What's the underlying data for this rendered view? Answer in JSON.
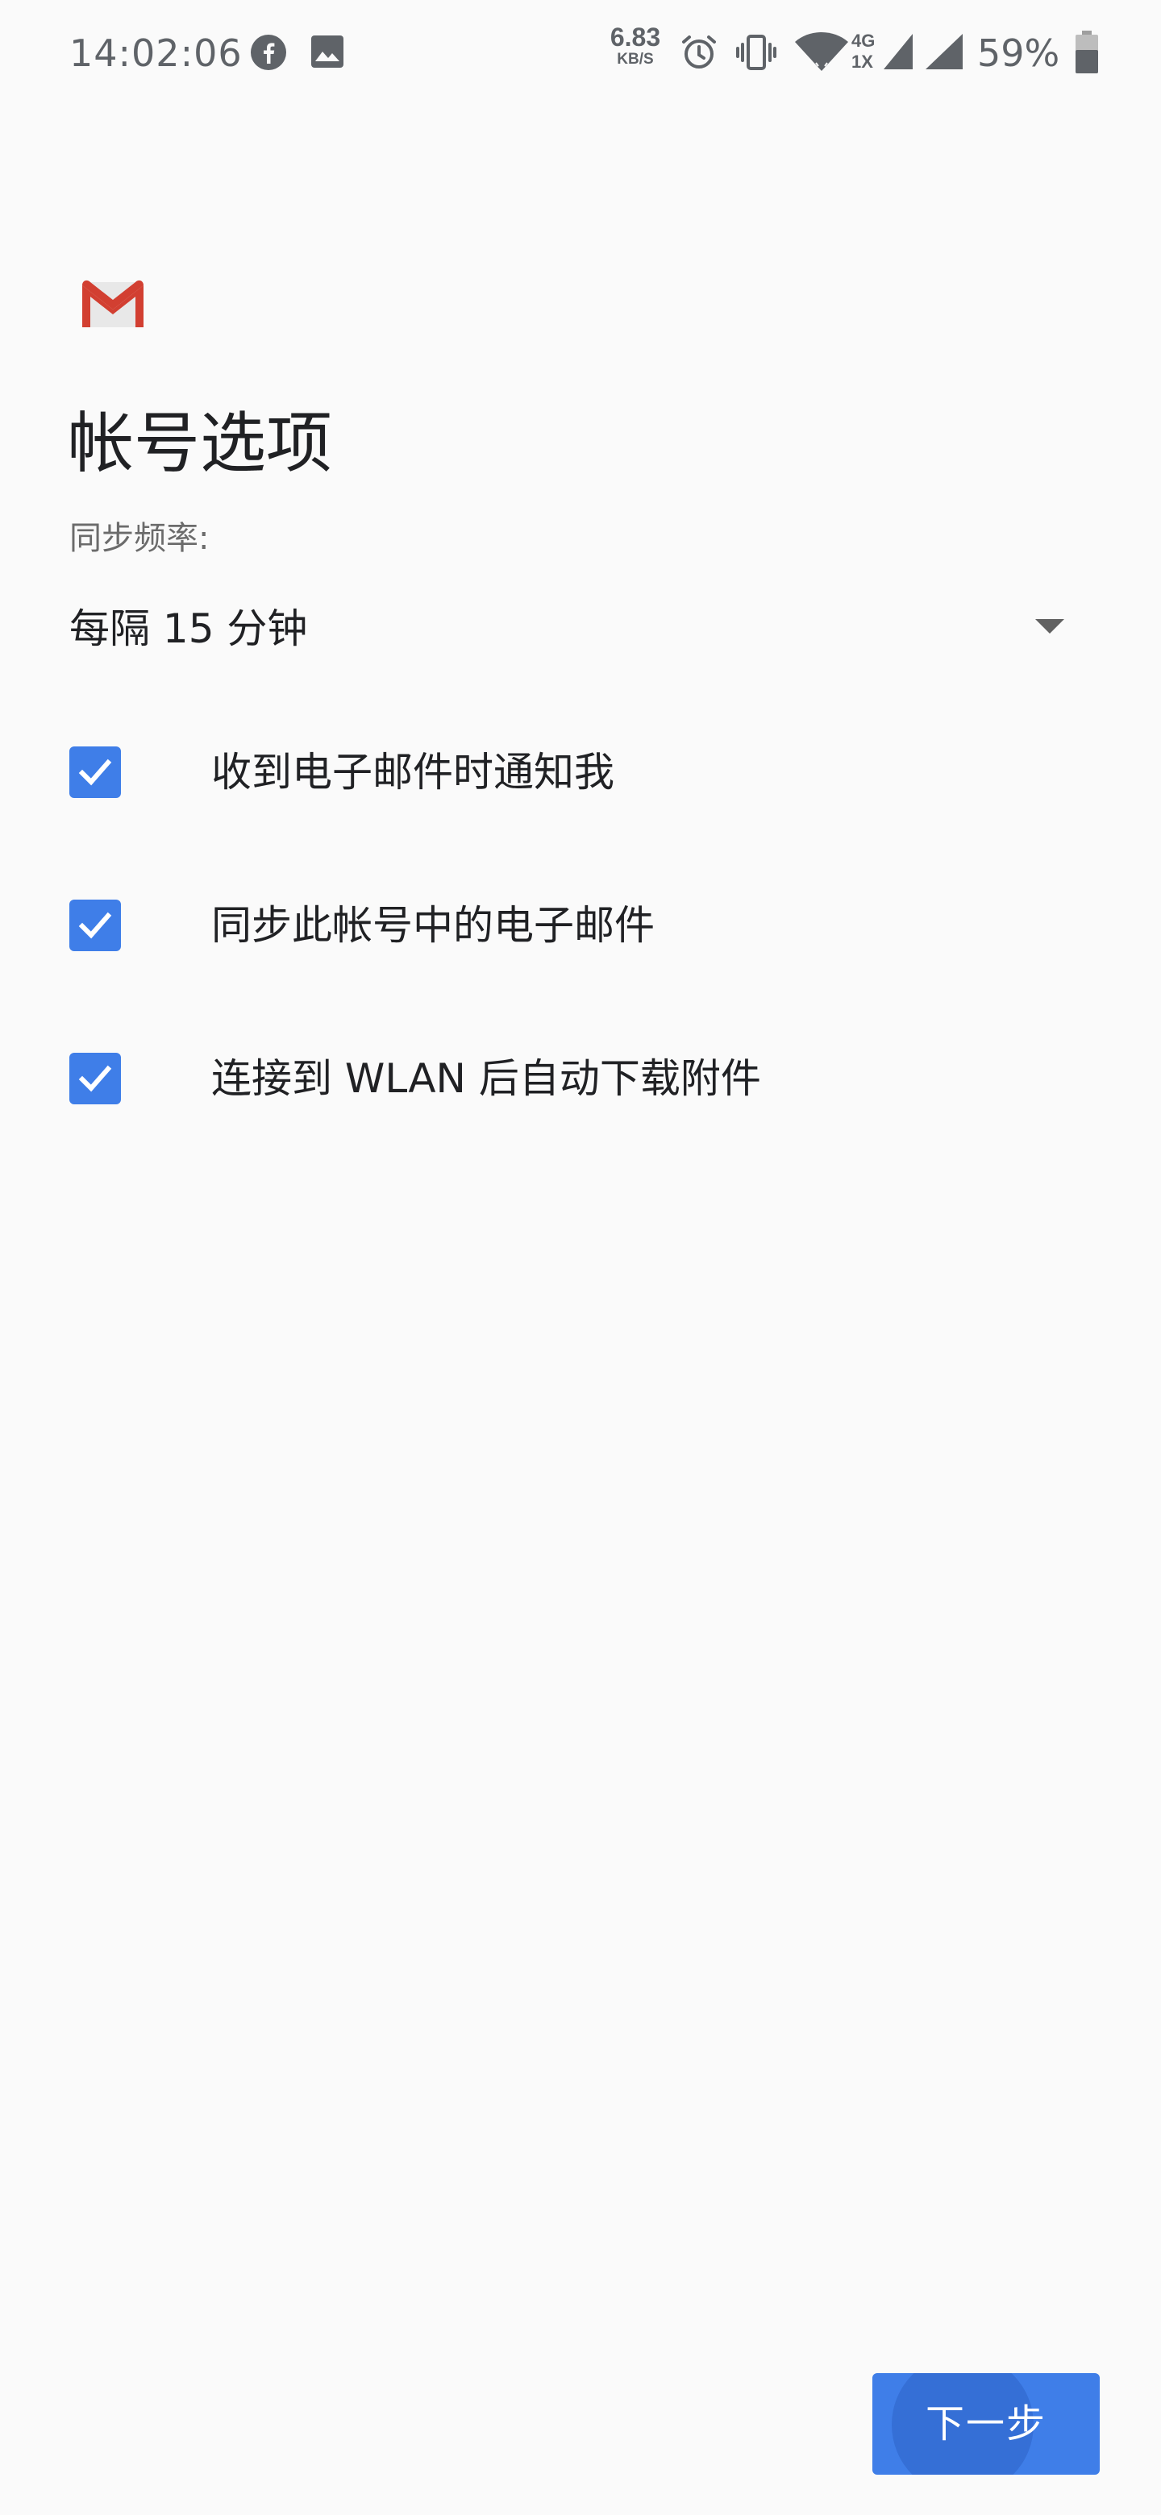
{
  "status_bar": {
    "time": "14:02:06",
    "speed_value": "6.83",
    "speed_unit": "KB/S",
    "network_top": "4G",
    "network_bottom": "1X",
    "battery": "59%",
    "icons": [
      "facebook-icon",
      "image-icon",
      "alarm-icon",
      "vibrate-icon",
      "wifi-icon",
      "mobile-signal-icon",
      "signal-icon",
      "battery-icon"
    ]
  },
  "app": {
    "logo": "gmail-logo"
  },
  "page": {
    "title": "帐号选项"
  },
  "sync": {
    "label": "同步频率:",
    "selected": "每隔 15 分钟"
  },
  "options": [
    {
      "label": "收到电子邮件时通知我",
      "checked": true
    },
    {
      "label": "同步此帐号中的电子邮件",
      "checked": true
    },
    {
      "label": "连接到 WLAN 后自动下载附件",
      "checked": true
    }
  ],
  "actions": {
    "next_label": "下一步"
  },
  "colors": {
    "accent": "#3f7ee8",
    "background": "#fafafa",
    "text_primary": "#202124",
    "text_secondary": "#6b6b6b",
    "gmail_red": "#d23f31"
  }
}
